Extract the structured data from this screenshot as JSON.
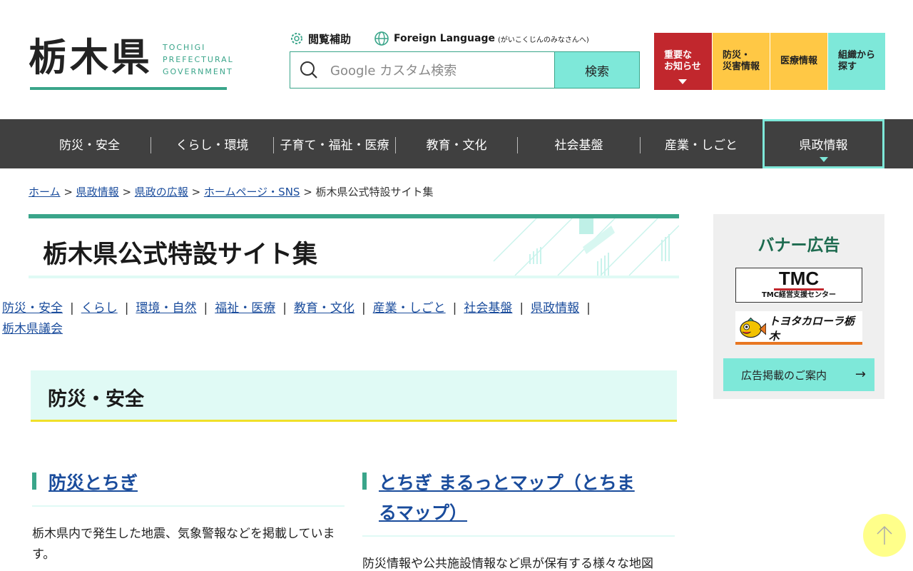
{
  "header": {
    "logo_kanji": "栃木県",
    "logo_en_1": "TOCHIGI",
    "logo_en_2": "PREFECTURAL",
    "logo_en_3": "GOVERNMENT",
    "reading_assist": "閲覧補助",
    "foreign_language": "Foreign Language",
    "foreign_language_note": "(がいこくじんのみなさんへ)",
    "search_placeholder": "Google カスタム検索",
    "search_button": "検索",
    "quick": [
      {
        "line1": "重要な",
        "line2": "お知らせ"
      },
      {
        "line1": "防災・",
        "line2": "災害情報"
      },
      {
        "line1": "医療情報",
        "line2": ""
      },
      {
        "line1": "組織から",
        "line2": "探す"
      }
    ]
  },
  "gnav": [
    "防災・安全",
    "くらし・環境",
    "子育て・福祉・医療",
    "教育・文化",
    "社会基盤",
    "産業・しごと",
    "県政情報"
  ],
  "breadcrumb": {
    "home": "ホーム",
    "l1": "県政情報",
    "l2": "県政の広報",
    "l3": "ホームページ・SNS",
    "current": "栃木県公式特設サイト集",
    "sep": " > "
  },
  "page_title": "栃木県公式特設サイト集",
  "categories": [
    "防災・安全",
    "くらし",
    "環境・自然",
    "福祉・医療",
    "教育・文化",
    "産業・しごと",
    "社会基盤",
    "県政情報",
    "栃木県議会"
  ],
  "cat_sep": "|",
  "section_title": "防災・安全",
  "cards": [
    {
      "title": "防災とちぎ",
      "desc": "栃木県内で発生した地震、気象警報などを掲載しています。"
    },
    {
      "title_line1": "とちぎ まるっとマップ（とちま",
      "title_line2": "るマップ）",
      "desc": "防災情報や公共施設情報など県が保有する様々な地図"
    }
  ],
  "side": {
    "title": "バナー広告",
    "banner1_big": "TMC",
    "banner1_small": "TMC経営支援センター",
    "banner2_text": "トヨタカローラ栃木",
    "ad_link": "広告掲載のご案内",
    "arrow": "→"
  },
  "colors": {
    "accent_green": "#3aa58a",
    "mint": "#7ee8d9",
    "red": "#c1272d",
    "yellow": "#ffc845",
    "nav_bg": "#404040"
  }
}
